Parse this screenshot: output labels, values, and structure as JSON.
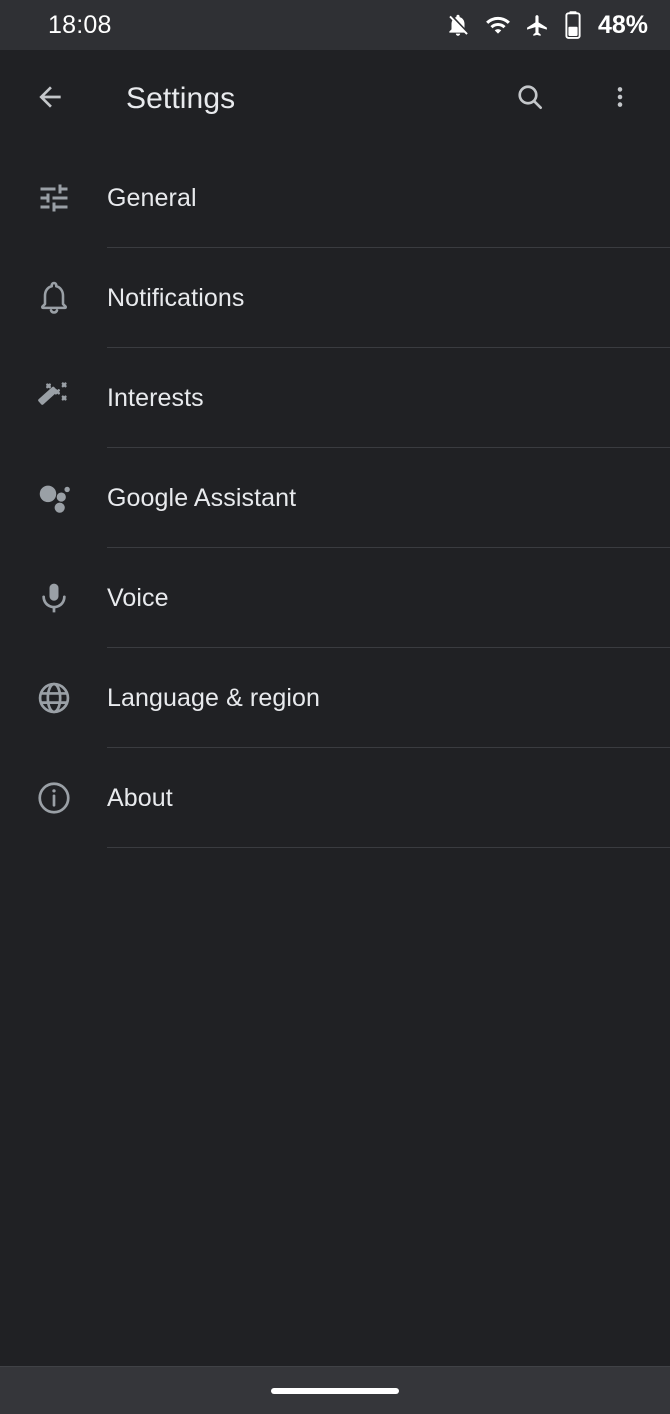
{
  "status_bar": {
    "time": "18:08",
    "battery_percent": "48%",
    "icons": [
      {
        "name": "notifications-off-icon"
      },
      {
        "name": "wifi-icon"
      },
      {
        "name": "airplane-mode-icon"
      },
      {
        "name": "battery-icon"
      }
    ],
    "background_color": "#2f3034",
    "text_color": "#ffffff"
  },
  "app_bar": {
    "back_label": "back-arrow",
    "title": "Settings",
    "search_label": "search-icon",
    "overflow_label": "more-options-icon",
    "background_color": "#202124",
    "title_color": "#e8eaed"
  },
  "settings_list": {
    "divider_color": "#3a3c40",
    "icon_color": "#9aa0a6",
    "items": [
      {
        "label": "General",
        "icon": "tune-icon"
      },
      {
        "label": "Notifications",
        "icon": "bell-icon"
      },
      {
        "label": "Interests",
        "icon": "magic-wand-icon"
      },
      {
        "label": "Google Assistant",
        "icon": "google-assistant-icon"
      },
      {
        "label": "Voice",
        "icon": "microphone-icon"
      },
      {
        "label": "Language & region",
        "icon": "globe-icon"
      },
      {
        "label": "About",
        "icon": "info-circle-icon"
      }
    ]
  },
  "nav_bar": {
    "gesture_pill": "home-indicator",
    "background_color": "#35363a",
    "pill_color": "#ffffff"
  }
}
